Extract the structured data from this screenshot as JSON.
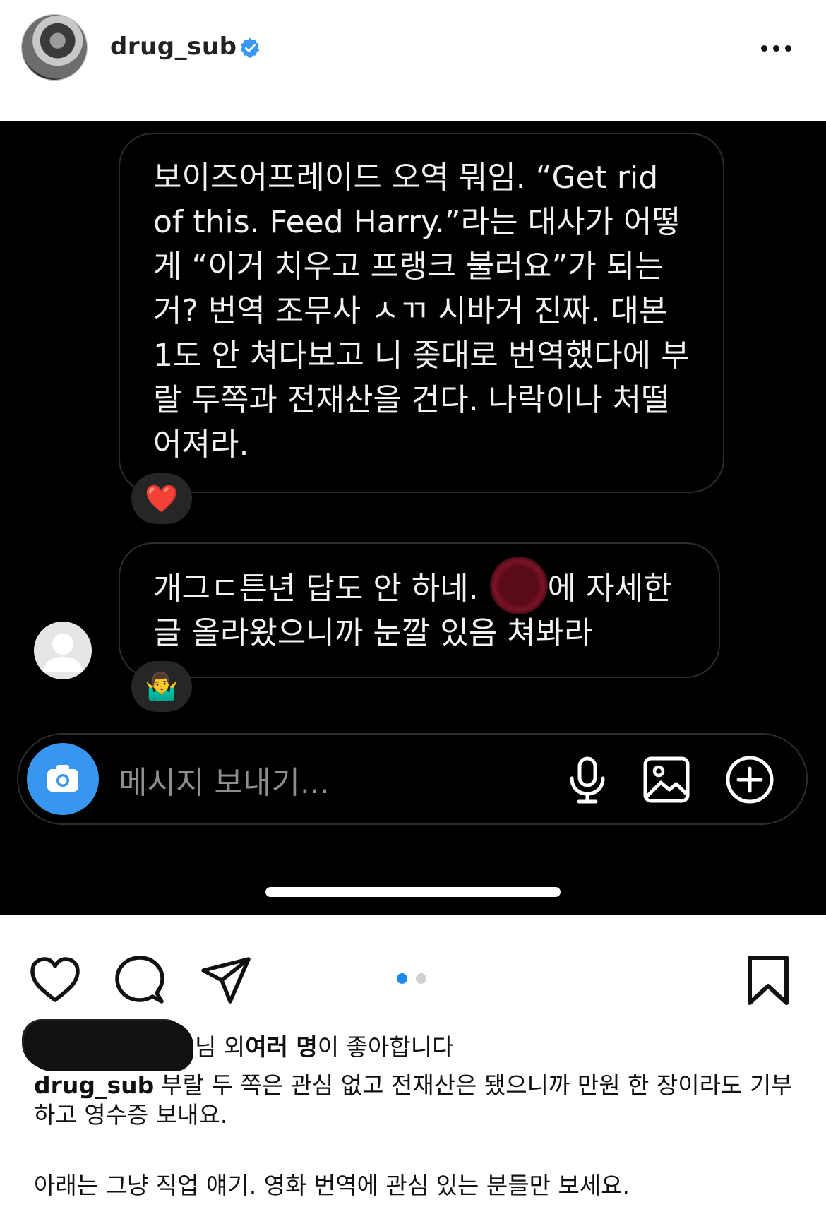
{
  "header": {
    "username": "drug_sub",
    "verified_icon": "verified-badge-icon",
    "more_icon": "more-options-icon"
  },
  "screenshot": {
    "messages": [
      {
        "text": "보이즈어프레이드 오역 뭐임. “Get rid\nof this. Feed Harry.”라는 대사가 어떻\n게 “이거 치우고 프랭크 불러요”가 되는\n거? 번역 조무사 ㅅㄲ 시바거 진짜. 대본\n1도 안 쳐다보고 니 좆대로 번역했다에 부\n랄 두쪽과 전재산을 건다. 나락이나 처떨\n어져라.",
        "reaction": "❤️"
      },
      {
        "text": "개그ㄷ튼년 답도 안 하네.       에 자세한\n글 올라왔으니까 눈깔 있음 쳐봐라",
        "reaction": "🤷‍♂️"
      }
    ],
    "input_placeholder": "메시지 보내기...",
    "accent_color": "#3797f0"
  },
  "actions": {
    "like_icon": "heart-icon",
    "comment_icon": "comment-icon",
    "share_icon": "send-icon",
    "save_icon": "bookmark-icon",
    "carousel_index": 1,
    "carousel_count": 2
  },
  "likes": {
    "suffix_1": "님 외 ",
    "bold": "여러 명",
    "suffix_2": "이 좋아합니다"
  },
  "caption": {
    "username": "drug_sub",
    "text": "부랄 두 쪽은 관심 없고 전재산은 됐으니까 만원 한 장이라도 기부하고 영수증 보내요.",
    "text_2": "아래는 그냥 직업 얘기. 영화 번역에 관심 있는 분들만 보세요."
  }
}
